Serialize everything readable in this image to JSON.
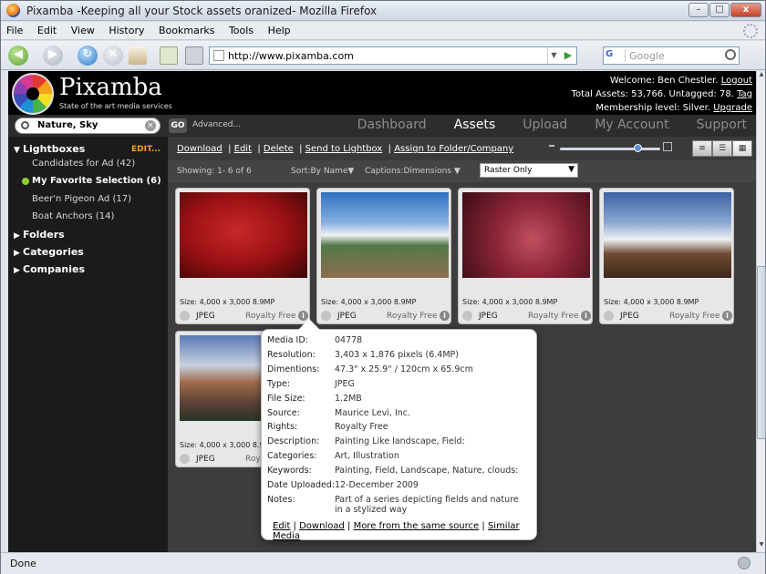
{
  "window": {
    "title": "Pixamba -Keeping all your  Stock assets oranized- Mozilla Firefox",
    "controls": {
      "min": "–",
      "max": "□",
      "close": "x"
    }
  },
  "menu": [
    "File",
    "Edit",
    "View",
    "History",
    "Bookmarks",
    "Tools",
    "Help"
  ],
  "nav": {
    "url": "http://www.pixamba.com",
    "search_placeholder": "Google",
    "search_engine": "G"
  },
  "header": {
    "brand": "Pixamba",
    "tagline": "State of the art media services",
    "welcome_prefix": "Welcome: Ben Chestler.",
    "logout": "Logout",
    "totals_prefix": "Total Assets: 53,766. Untagged: 78.",
    "tag": "Tag",
    "membership_prefix": "Membership level: Silver.",
    "upgrade": "Upgrade"
  },
  "search": {
    "value": "Nature, Sky",
    "go": "GO",
    "advanced": "Advanced..."
  },
  "tabs": [
    {
      "label": "Dashboard",
      "active": false
    },
    {
      "label": "Assets",
      "active": true
    },
    {
      "label": "Upload",
      "active": false
    },
    {
      "label": "My Account",
      "active": false
    },
    {
      "label": "Support",
      "active": false
    }
  ],
  "sidebar": {
    "lightboxes_label": "Lightboxes",
    "edit_label": "EDIT...",
    "lightboxes": [
      {
        "label": "Candidates for Ad (42)",
        "selected": false
      },
      {
        "label": "My Favorite Selection (6)",
        "selected": true
      },
      {
        "label": "Beer'n Pigeon Ad (17)",
        "selected": false
      },
      {
        "label": "Boat Anchors (14)",
        "selected": false
      }
    ],
    "folders_label": "Folders",
    "categories_label": "Categories",
    "companies_label": "Companies"
  },
  "actions": {
    "download": "Download",
    "edit": "Edit",
    "delete": "Delete",
    "send": "Send to Lightbox",
    "assign": "Assign to Folder/Company",
    "zoom_level": 0.78
  },
  "filter": {
    "showing": "Showing: 1- 6 of 6",
    "sort": "Sort:By Name",
    "captions": "Captions:Dimensions",
    "raster": "Raster Only"
  },
  "assets": [
    {
      "size": "Size: 4,000 x 3,000 8.9MP",
      "type": "JPEG",
      "license": "Royalty Free",
      "thumb": "strawberry"
    },
    {
      "size": "Size: 4,000 x 3,000 8.9MP",
      "type": "JPEG",
      "license": "Royalty Free",
      "thumb": "field-sky"
    },
    {
      "size": "Size: 4,000 x 3,000 8.9MP",
      "type": "JPEG",
      "license": "Royalty Free",
      "thumb": "apple"
    },
    {
      "size": "Size: 4,000 x 3,000 8.9MP",
      "type": "JPEG",
      "license": "Royalty Free",
      "thumb": "desert-sky"
    },
    {
      "size": "Size: 4,000 x 3,000 8.9",
      "type": "JPEG",
      "license": "Roy",
      "thumb": "houses"
    }
  ],
  "popup": {
    "rows": [
      {
        "label": "Media ID:",
        "value": "04778"
      },
      {
        "label": "Resolution:",
        "value": "3,403 x 1,876 pixels (6.4MP)"
      },
      {
        "label": "Dimentions:",
        "value": "47.3\" x 25.9\" / 120cm x 65.9cm"
      },
      {
        "label": "Type:",
        "value": "JPEG"
      },
      {
        "label": "File Size:",
        "value": "1.2MB"
      },
      {
        "label": "Source:",
        "value": "Maurice Levi, Inc."
      },
      {
        "label": "Rights:",
        "value": "Royalty Free"
      },
      {
        "label": "Description:",
        "value": "Painting Like landscape, Field:"
      },
      {
        "label": "Categories:",
        "value": "Art, Illustration"
      },
      {
        "label": "Keywords:",
        "value": "Painting, Field, Landscape, Nature, clouds:"
      },
      {
        "label": "Date Uploaded:",
        "value": "12-December 2009"
      },
      {
        "label": "Notes:",
        "value": "Part of a series depicting fields and nature in a stylized way"
      }
    ],
    "links": {
      "edit": "Edit",
      "download": "Download",
      "more": "More from the same source",
      "similar": "Similar Media"
    }
  },
  "status": {
    "text": "Done"
  }
}
